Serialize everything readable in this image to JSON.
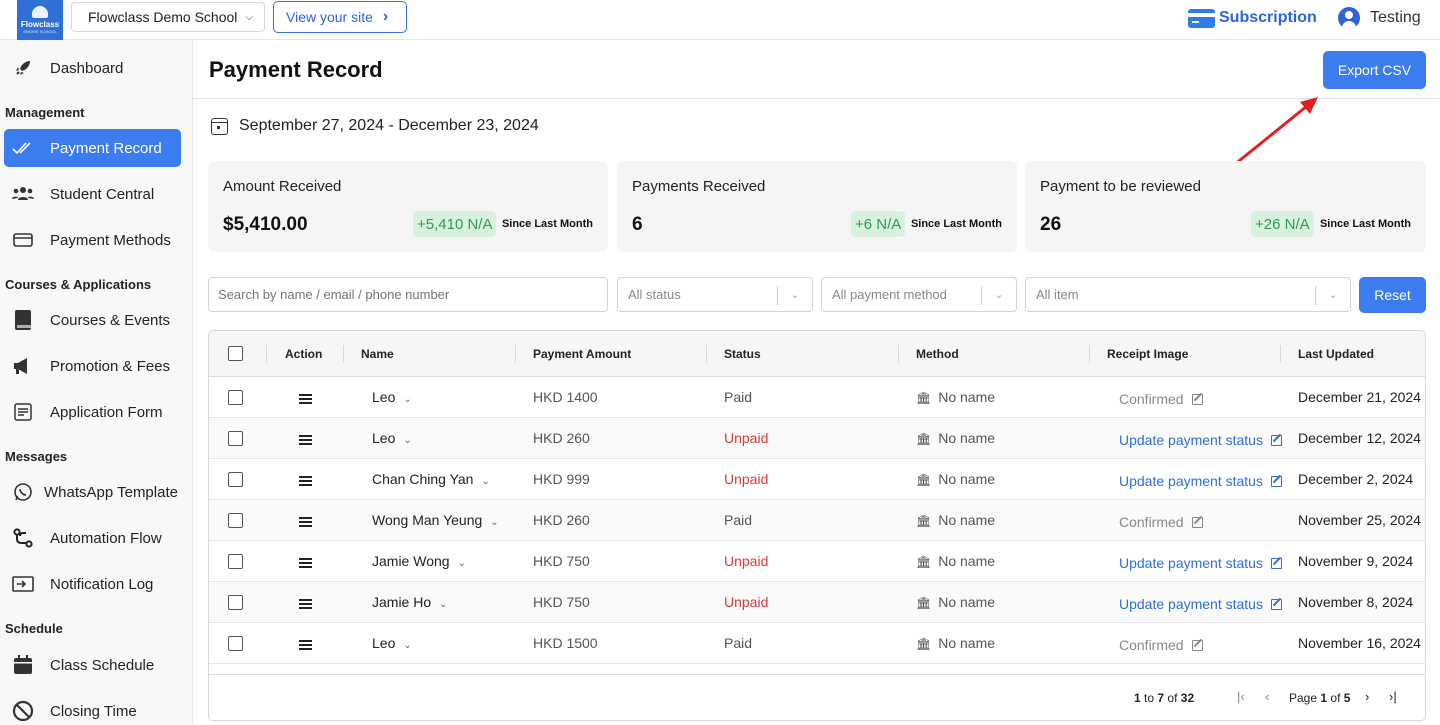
{
  "topbar": {
    "logo_brand": "Flowclass",
    "logo_tag": "ENGINE SCHOOL",
    "school_name": "Flowclass Demo School",
    "view_site_label": "View your site",
    "subscription_label": "Subscription",
    "user_name": "Testing"
  },
  "sidebar": {
    "dashboard": "Dashboard",
    "section_management": "Management",
    "payment_record": "Payment Record",
    "student_central": "Student Central",
    "payment_methods": "Payment Methods",
    "section_courses": "Courses & Applications",
    "courses_events": "Courses & Events",
    "promotion_fees": "Promotion & Fees",
    "application_form": "Application Form",
    "section_messages": "Messages",
    "whatsapp_template": "WhatsApp Template",
    "automation_flow": "Automation Flow",
    "notification_log": "Notification Log",
    "section_schedule": "Schedule",
    "class_schedule": "Class Schedule",
    "closing_time": "Closing Time"
  },
  "page": {
    "title": "Payment Record",
    "export_label": "Export CSV",
    "date_range": "September 27, 2024 - December 23, 2024"
  },
  "stats": [
    {
      "label": "Amount Received",
      "value": "$5,410.00",
      "delta": "+5,410 N/A",
      "since": "Since Last Month"
    },
    {
      "label": "Payments Received",
      "value": "6",
      "delta": "+6 N/A",
      "since": "Since Last Month"
    },
    {
      "label": "Payment to be reviewed",
      "value": "26",
      "delta": "+26 N/A",
      "since": "Since Last Month"
    }
  ],
  "filters": {
    "search_placeholder": "Search by name / email / phone number",
    "status": "All status",
    "payment_method": "All payment method",
    "item": "All item",
    "reset_label": "Reset"
  },
  "table": {
    "headers": {
      "action": "Action",
      "name": "Name",
      "amount": "Payment Amount",
      "status": "Status",
      "method": "Method",
      "receipt": "Receipt Image",
      "updated": "Last Updated"
    },
    "rows": [
      {
        "name": "Leo",
        "amount": "HKD 1400",
        "status": "Paid",
        "method": "No name",
        "receipt": "Confirmed",
        "updated": "December 21, 2024"
      },
      {
        "name": "Leo",
        "amount": "HKD 260",
        "status": "Unpaid",
        "method": "No name",
        "receipt": "Update payment status",
        "updated": "December 12, 2024"
      },
      {
        "name": "Chan Ching Yan",
        "amount": "HKD 999",
        "status": "Unpaid",
        "method": "No name",
        "receipt": "Update payment status",
        "updated": "December 2, 2024"
      },
      {
        "name": "Wong Man Yeung",
        "amount": "HKD 260",
        "status": "Paid",
        "method": "No name",
        "receipt": "Confirmed",
        "updated": "November 25, 2024"
      },
      {
        "name": "Jamie Wong",
        "amount": "HKD 750",
        "status": "Unpaid",
        "method": "No name",
        "receipt": "Update payment status",
        "updated": "November 9, 2024"
      },
      {
        "name": "Jamie Ho",
        "amount": "HKD 750",
        "status": "Unpaid",
        "method": "No name",
        "receipt": "Update payment status",
        "updated": "November 8, 2024"
      },
      {
        "name": "Leo",
        "amount": "HKD 1500",
        "status": "Paid",
        "method": "No name",
        "receipt": "Confirmed",
        "updated": "November 16, 2024"
      }
    ]
  },
  "pagination": {
    "from": "1",
    "to_word": "to",
    "to": "7",
    "of_word": "of",
    "total": "32",
    "page_word": "Page",
    "page": "1",
    "pages": "5"
  },
  "colors": {
    "accent": "#3b7cef",
    "paid": "#555555",
    "unpaid": "#d93a3a",
    "link": "#2f6fd8",
    "annotation_arrow": "#e02020"
  }
}
